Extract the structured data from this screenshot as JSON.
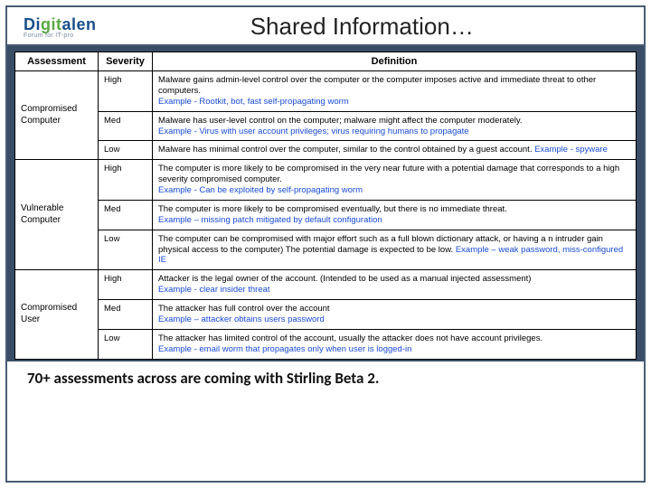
{
  "logo": {
    "part1": "Di",
    "part2": "git",
    "part3": "alen",
    "subtitle": "Forum for IT-pro"
  },
  "title": "Shared Information…",
  "headers": {
    "assessment": "Assessment",
    "severity": "Severity",
    "definition": "Definition"
  },
  "groups": [
    {
      "assessment": "Compromised Computer",
      "rows": [
        {
          "sev": "High",
          "def": "Malware gains admin-level control over the computer or the computer imposes active and immediate threat to other computers.",
          "example": "Example - Rootkit, bot, fast self-propagating worm"
        },
        {
          "sev": "Med",
          "def": "Malware has user-level control on the computer; malware might affect the computer moderately.",
          "example": "Example - Virus with user account privileges;  virus requiring humans to propagate"
        },
        {
          "sev": "Low",
          "def": "Malware has minimal control over the computer, similar to the control obtained by a guest account. ",
          "example": "Example - spyware"
        }
      ]
    },
    {
      "assessment": "Vulnerable Computer",
      "rows": [
        {
          "sev": "High",
          "def": "The computer is more likely to be  compromised in the very near future with a potential damage that corresponds to a high severity compromised computer.",
          "example": "Example - Can be exploited by self-propagating worm"
        },
        {
          "sev": "Med",
          "def": "The computer is more likely to be compromised eventually, but there is no immediate threat.",
          "example": "Example – missing patch mitigated by default configuration"
        },
        {
          "sev": "Low",
          "def": "The computer can be compromised  with major effort such as a full blown dictionary attack, or having a n intruder gain physical access to the computer) The potential damage is expected to be low. ",
          "example": "Example – weak password, miss-configured IE"
        }
      ]
    },
    {
      "assessment": "Compromised User",
      "rows": [
        {
          "sev": "High",
          "def": "Attacker is the legal owner of the account. (Intended to be used as a manual injected assessment)",
          "example": " Example -  clear insider threat"
        },
        {
          "sev": "Med",
          "def": "The attacker has full control over the account",
          "example": "Example – attacker obtains users password"
        },
        {
          "sev": "Low",
          "def": "The attacker has limited control of the account, usually the attacker does not have account privileges.  ",
          "example": "Example -  email worm that propagates only when user is logged-in"
        }
      ]
    }
  ],
  "footer": "70+ assessments across are coming with Stirling Beta 2."
}
